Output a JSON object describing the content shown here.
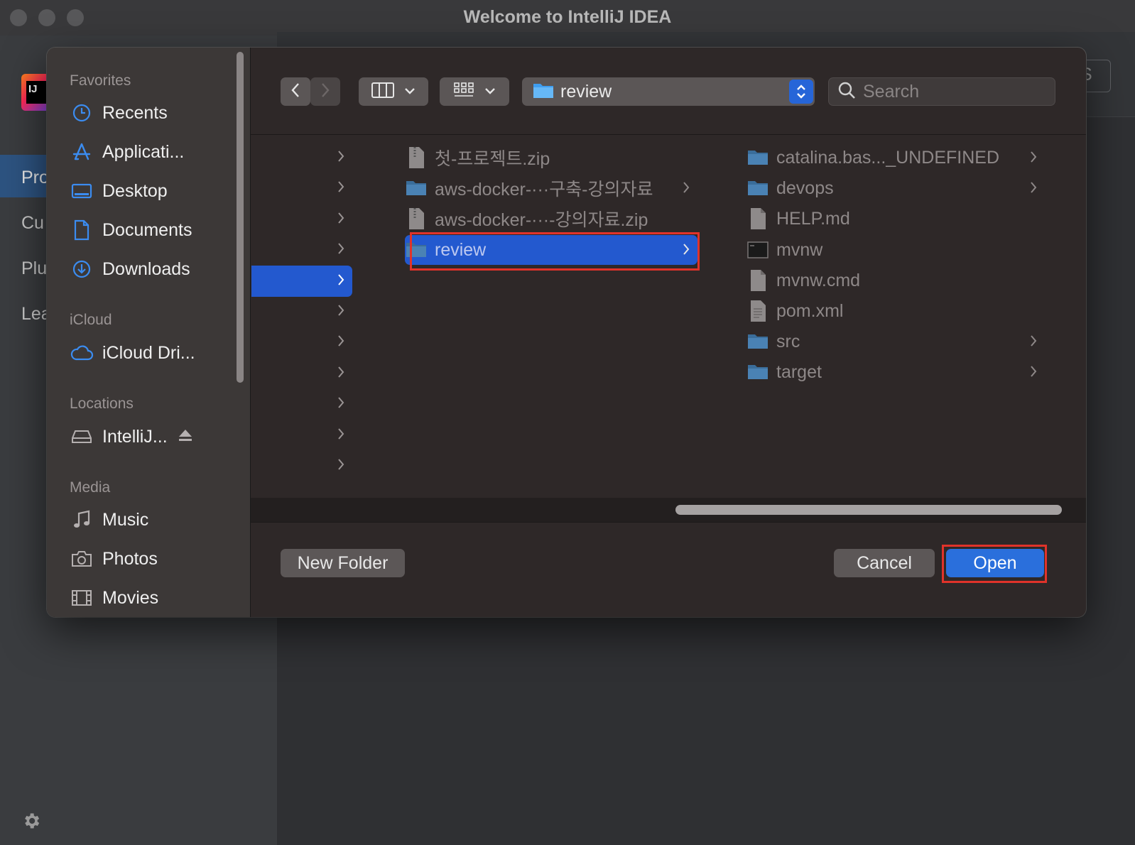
{
  "window": {
    "title": "Welcome to IntelliJ IDEA"
  },
  "ij_sidebar": {
    "logo_text": "IJ",
    "nav": [
      "Pro",
      "Cu",
      "Plu",
      "Lea"
    ],
    "right_button_text": "S"
  },
  "dialog": {
    "sidebar": {
      "favorites_header": "Favorites",
      "favorites": [
        {
          "label": "Recents",
          "icon": "clock-icon"
        },
        {
          "label": "Applicati...",
          "icon": "applications-icon"
        },
        {
          "label": "Desktop",
          "icon": "desktop-icon"
        },
        {
          "label": "Documents",
          "icon": "document-icon"
        },
        {
          "label": "Downloads",
          "icon": "downloads-icon"
        }
      ],
      "icloud_header": "iCloud",
      "icloud": [
        {
          "label": "iCloud Dri...",
          "icon": "cloud-icon"
        }
      ],
      "locations_header": "Locations",
      "locations": [
        {
          "label": "IntelliJ...",
          "icon": "disk-icon"
        }
      ],
      "media_header": "Media",
      "media": [
        {
          "label": "Music",
          "icon": "music-icon"
        },
        {
          "label": "Photos",
          "icon": "camera-icon"
        },
        {
          "label": "Movies",
          "icon": "film-icon"
        }
      ]
    },
    "toolbar": {
      "path": "review",
      "search_placeholder": "Search"
    },
    "column2": [
      {
        "name": "첫-프로젝트.zip",
        "kind": "zip",
        "folder": false
      },
      {
        "name": "aws-docker-···구축-강의자료",
        "kind": "folder",
        "folder": true
      },
      {
        "name": "aws-docker-···-강의자료.zip",
        "kind": "zip",
        "folder": false
      },
      {
        "name": "review",
        "kind": "folder",
        "folder": true,
        "selected": true
      }
    ],
    "column3": [
      {
        "name": "catalina.bas..._UNDEFINED",
        "kind": "folder",
        "folder": true
      },
      {
        "name": "devops",
        "kind": "folder",
        "folder": true
      },
      {
        "name": "HELP.md",
        "kind": "file",
        "folder": false
      },
      {
        "name": "mvnw",
        "kind": "exec",
        "folder": false
      },
      {
        "name": "mvnw.cmd",
        "kind": "file",
        "folder": false
      },
      {
        "name": "pom.xml",
        "kind": "xml",
        "folder": false
      },
      {
        "name": "src",
        "kind": "folder",
        "folder": true
      },
      {
        "name": "target",
        "kind": "folder",
        "folder": true
      }
    ],
    "buttons": {
      "new_folder": "New Folder",
      "cancel": "Cancel",
      "open": "Open"
    },
    "colors": {
      "selection": "#2359cf",
      "accent": "#2a6fdc",
      "highlight": "#e0332a"
    }
  }
}
